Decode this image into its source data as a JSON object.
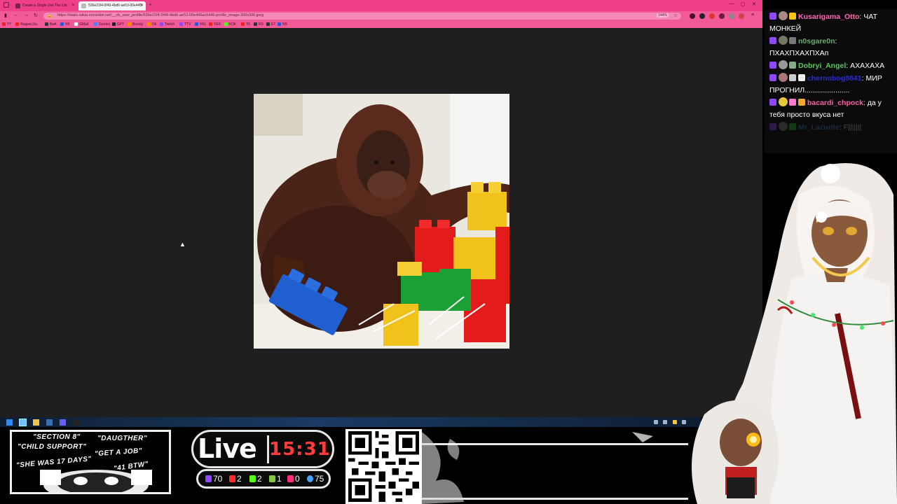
{
  "browser": {
    "tabs": [
      {
        "label": "Create a Single Use Tier List",
        "active": false
      },
      {
        "label": "536e21f4-0f49-4bd6-ae53-00e445",
        "active": true
      }
    ],
    "url": "https://static.wikia.nocookie.net/__cb_user_profile/536e21f4-0f49-4bd6-ae53-00e445ac6446-profile_image-300x300.jpeg",
    "zoom": "144%",
    "bookmarks": [
      "YT",
      "Яндекс.Ка",
      "ВиА",
      "VK",
      "GMail",
      "Gemini",
      "GPT",
      "Boosty",
      "Ok",
      "Twitch",
      "TTV",
      "VKL",
      "YES",
      "КОК",
      "ТК",
      "RS",
      "ET",
      "NS"
    ],
    "image_subject": "orangutan-with-lego"
  },
  "chat": {
    "messages": [
      {
        "user": "Kusarigama_Otto",
        "text": "ЧАТ МОНКЕЙ",
        "color": "#ff69b4"
      },
      {
        "user": "n0sgare0n",
        "text": "ПХАХПХАХПХАп",
        "color": "#6fa96f"
      },
      {
        "user": "Dobryi_Angel",
        "text": "АХАХАХА",
        "color": "#5cc95c"
      },
      {
        "user": "chernobog8641",
        "text": "МИР ПРОГНИЛ......................",
        "color": "#2b2bd6"
      },
      {
        "user": "bacardi_chpock",
        "text": "да у тебя просто вкуса нет",
        "color": "#ff5ea8"
      },
      {
        "user": "Mr_Lazurite",
        "text": "F|||||||",
        "color": "#4a7fd1"
      }
    ]
  },
  "overlay": {
    "meme_lines": [
      "\"SECTION 8\"",
      "\"DAUGTHER\"",
      "\"CHILD SUPPORT\"",
      "\"GET A JOB\"",
      "\"SHE WAS 17 DAYS\"",
      "\"41 BTW\""
    ],
    "live_label": "Live",
    "clock": "15:31",
    "stats": [
      {
        "platform": "twitch",
        "value": "70",
        "color": "#9147ff"
      },
      {
        "platform": "youtube",
        "value": "2",
        "color": "#ff2d2d"
      },
      {
        "platform": "kick",
        "value": "2",
        "color": "#53fc18"
      },
      {
        "platform": "rumble",
        "value": "1",
        "color": "#85c742"
      },
      {
        "platform": "vkplay",
        "value": "0",
        "color": "#ff2d7a"
      },
      {
        "platform": "total",
        "value": "75",
        "color": "#4aa3ff"
      }
    ]
  }
}
